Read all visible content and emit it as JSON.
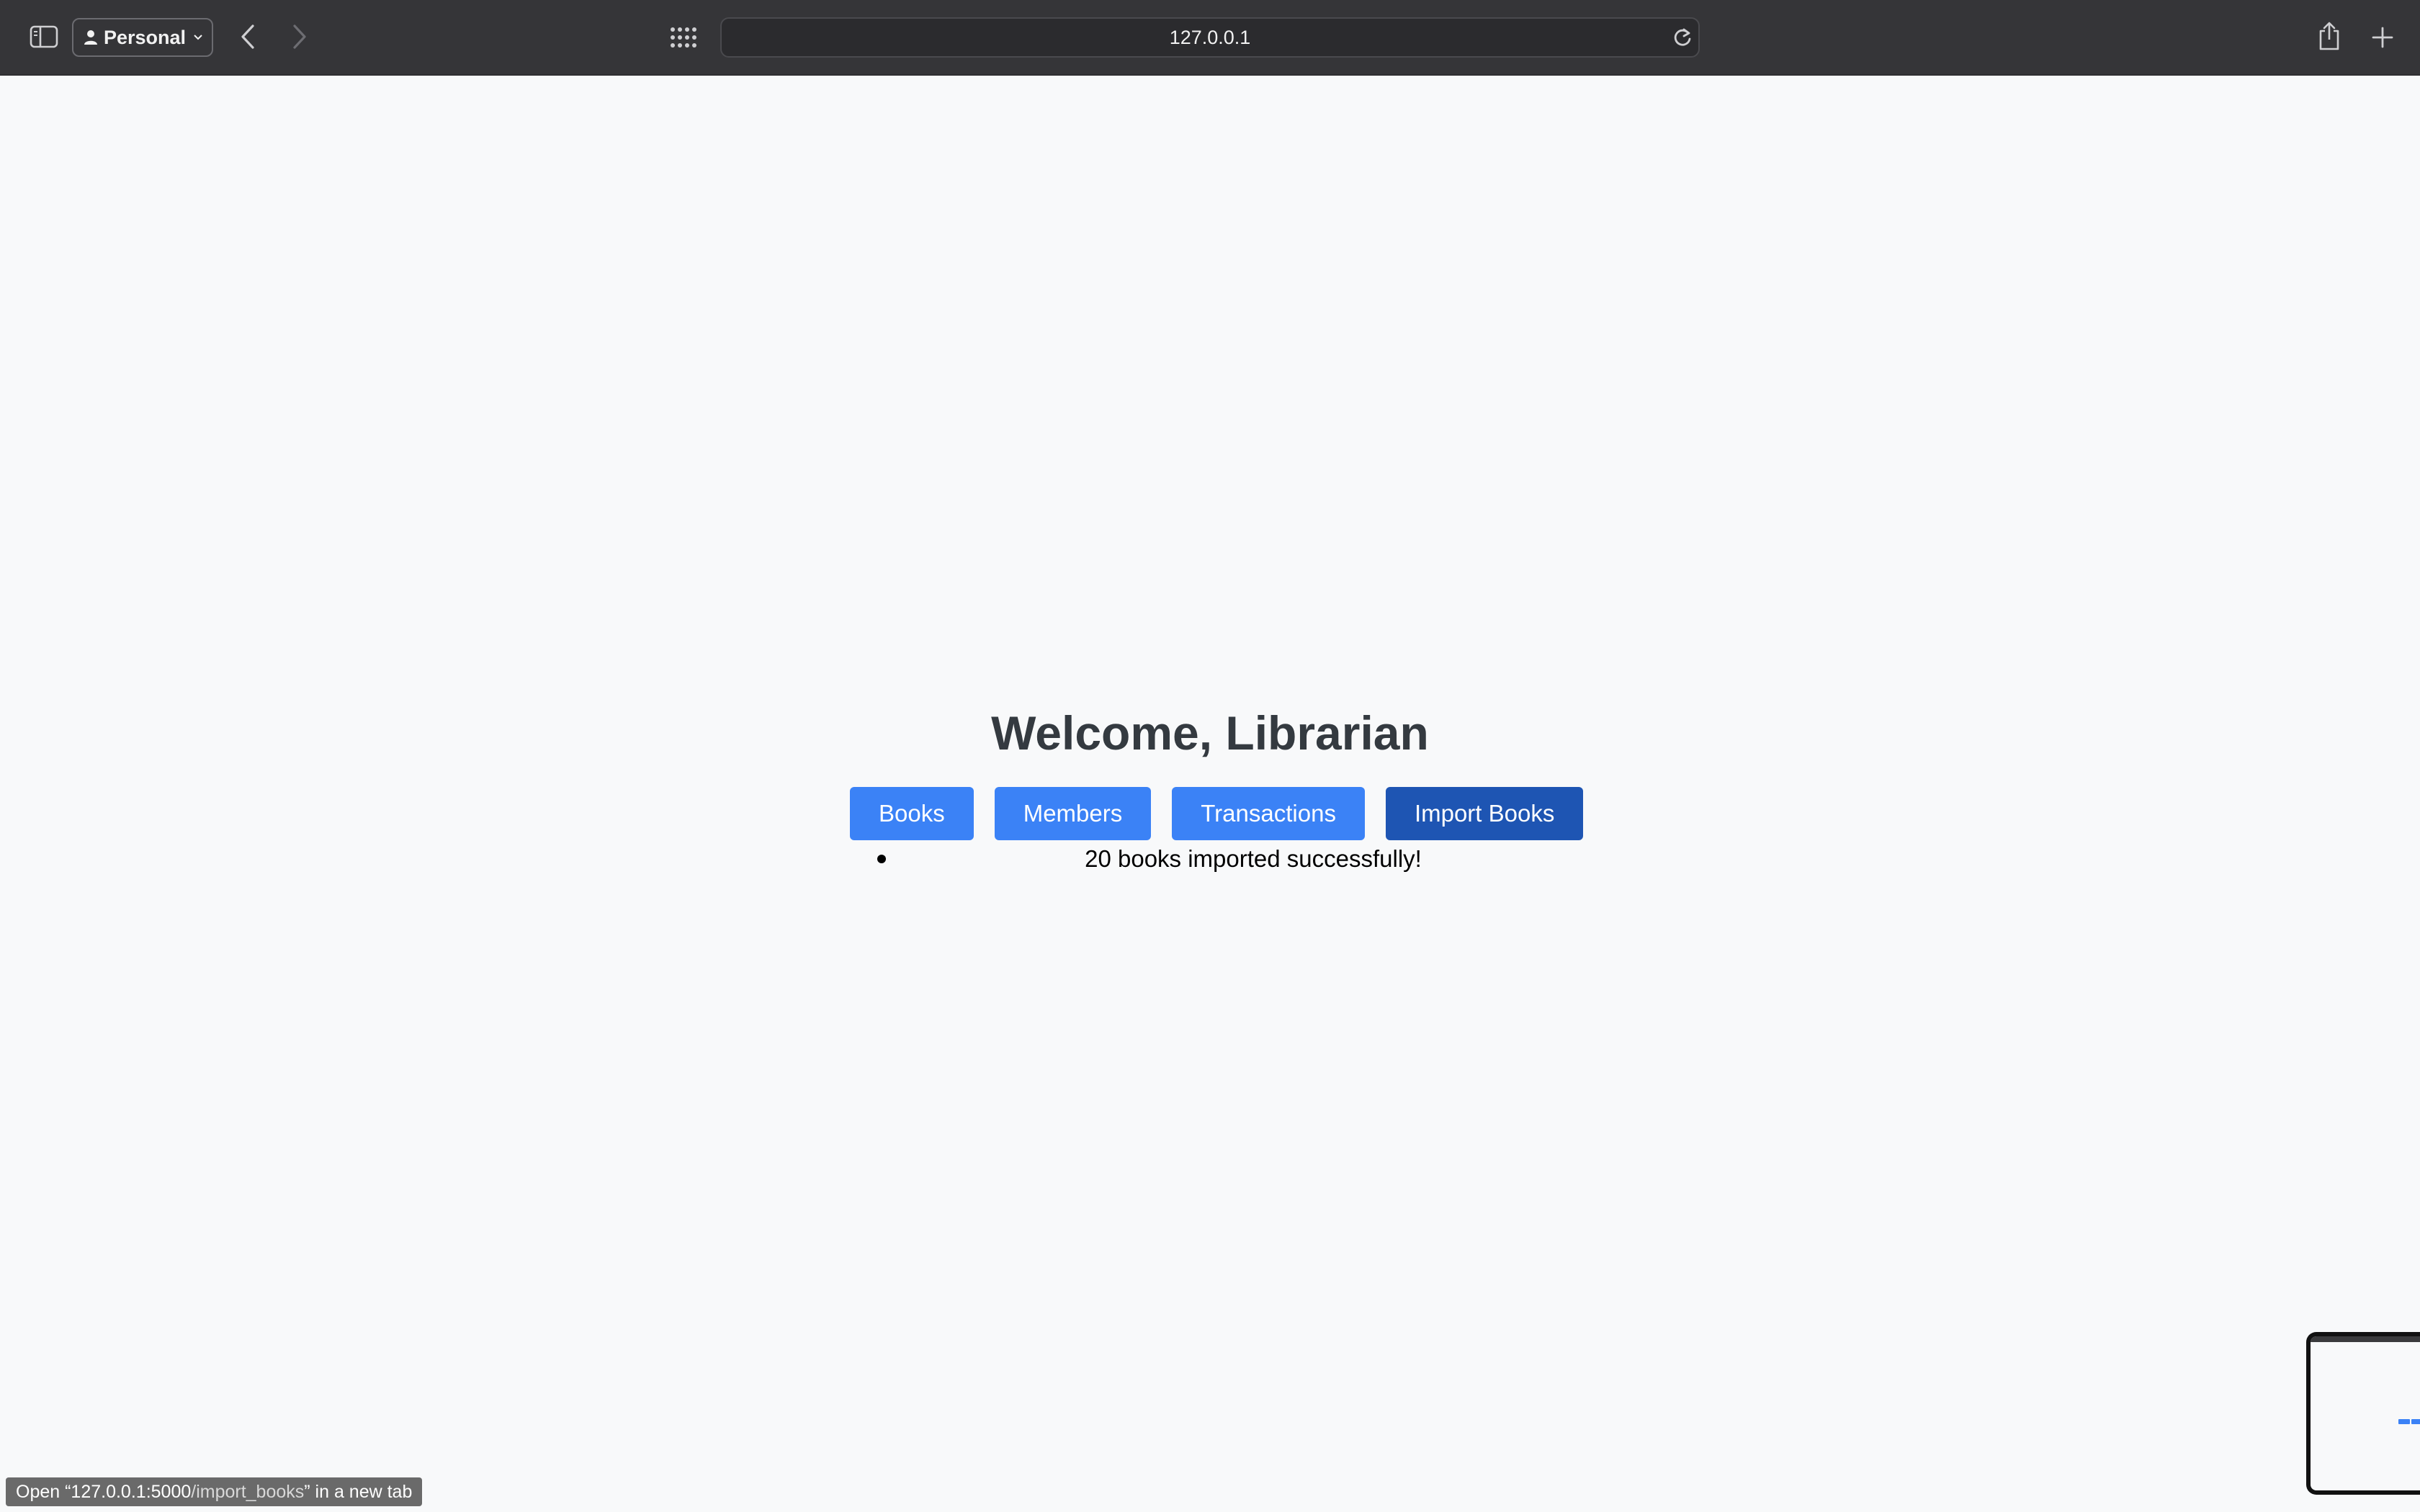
{
  "browser": {
    "profile_label": "Personal",
    "address": "127.0.0.1"
  },
  "page": {
    "title": "Welcome, Librarian",
    "nav": [
      {
        "label": "Books"
      },
      {
        "label": "Members"
      },
      {
        "label": "Transactions"
      },
      {
        "label": "Import Books"
      }
    ],
    "messages": [
      "20 books imported successfully!"
    ]
  },
  "status": {
    "prefix": "Open “127.0.0.1:5000",
    "path": "/import_books",
    "suffix": "” in a new tab"
  },
  "colors": {
    "nav_button": "#3b82f6",
    "nav_button_active": "#1e55b3",
    "title": "#343a40",
    "toolbar": "#353538"
  },
  "icons": [
    "sidebar-icon",
    "person-icon",
    "chevron-down-icon",
    "back-arrow-icon",
    "forward-arrow-icon",
    "grid-icon",
    "reload-icon",
    "share-icon",
    "plus-icon"
  ]
}
